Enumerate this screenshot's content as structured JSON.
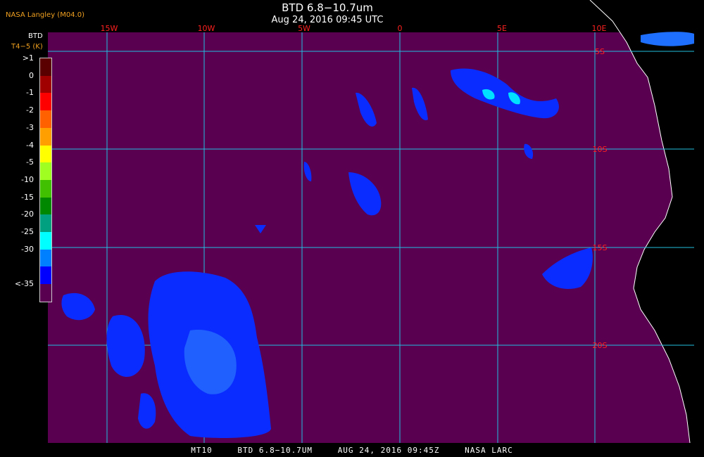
{
  "title": "BTD 6.8−10.7um",
  "subtitle": "Aug 24, 2016 09:45 UTC",
  "producer": "NASA Langley (M04.0)",
  "colorbar": {
    "label_line1": "BTD",
    "label_line2": "T4−5 (K)",
    "ticks": [
      ">1",
      "0",
      "-1",
      "-2",
      "-3",
      "-4",
      "-5",
      "-10",
      "-15",
      "-20",
      "-25",
      "-30",
      "<-35"
    ],
    "colors": [
      "#5a0000",
      "#a00000",
      "#ff0000",
      "#ff6000",
      "#ffa000",
      "#ffff00",
      "#a0ff20",
      "#40c000",
      "#008800",
      "#00a080",
      "#00ffff",
      "#0080ff",
      "#0000ff",
      "#5a0050"
    ]
  },
  "map": {
    "background_color": "#5a0050",
    "grid_color": "#20c0e0",
    "coast_color": "#ffffff",
    "lon_labels": [
      "15W",
      "10W",
      "5W",
      "0",
      "5E",
      "10E"
    ],
    "lat_labels": [
      "5S",
      "10S",
      "15S",
      "20S"
    ],
    "label_color": "#ff2020"
  },
  "footer": {
    "sat": "MT10",
    "product": "BTD 6.8−10.7UM",
    "datetime": "AUG 24, 2016 09:45Z",
    "agency": "NASA LARC"
  }
}
